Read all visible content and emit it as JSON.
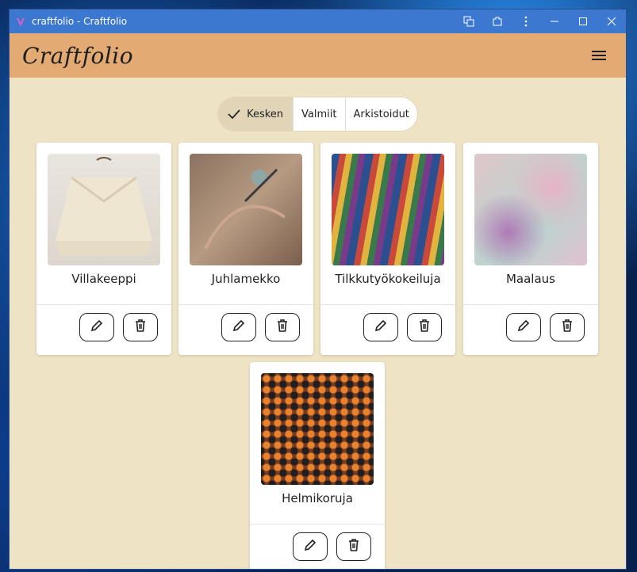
{
  "window": {
    "title": "craftfolio - Craftfolio"
  },
  "header": {
    "logo": "Craftfolio"
  },
  "filter": {
    "tabs": [
      {
        "label": "Kesken",
        "selected": true
      },
      {
        "label": "Valmiit",
        "selected": false
      },
      {
        "label": "Arkistoidut",
        "selected": false
      }
    ]
  },
  "projects": [
    {
      "name": "Villakeeppi",
      "image": "knitted-poncho"
    },
    {
      "name": "Juhlamekko",
      "image": "sewing-fabric"
    },
    {
      "name": "Tilkkutyökokeiluja",
      "image": "fabric-bolts"
    },
    {
      "name": "Maalaus",
      "image": "abstract-painting"
    },
    {
      "name": "Helmikoruja",
      "image": "beads"
    }
  ],
  "icons": {
    "edit": "pencil-icon",
    "delete": "trash-icon",
    "menu": "hamburger-icon",
    "check": "check-icon"
  },
  "colors": {
    "titlebar": "#3c78d0",
    "header": "#e3ab73",
    "background": "#efe3c6"
  }
}
